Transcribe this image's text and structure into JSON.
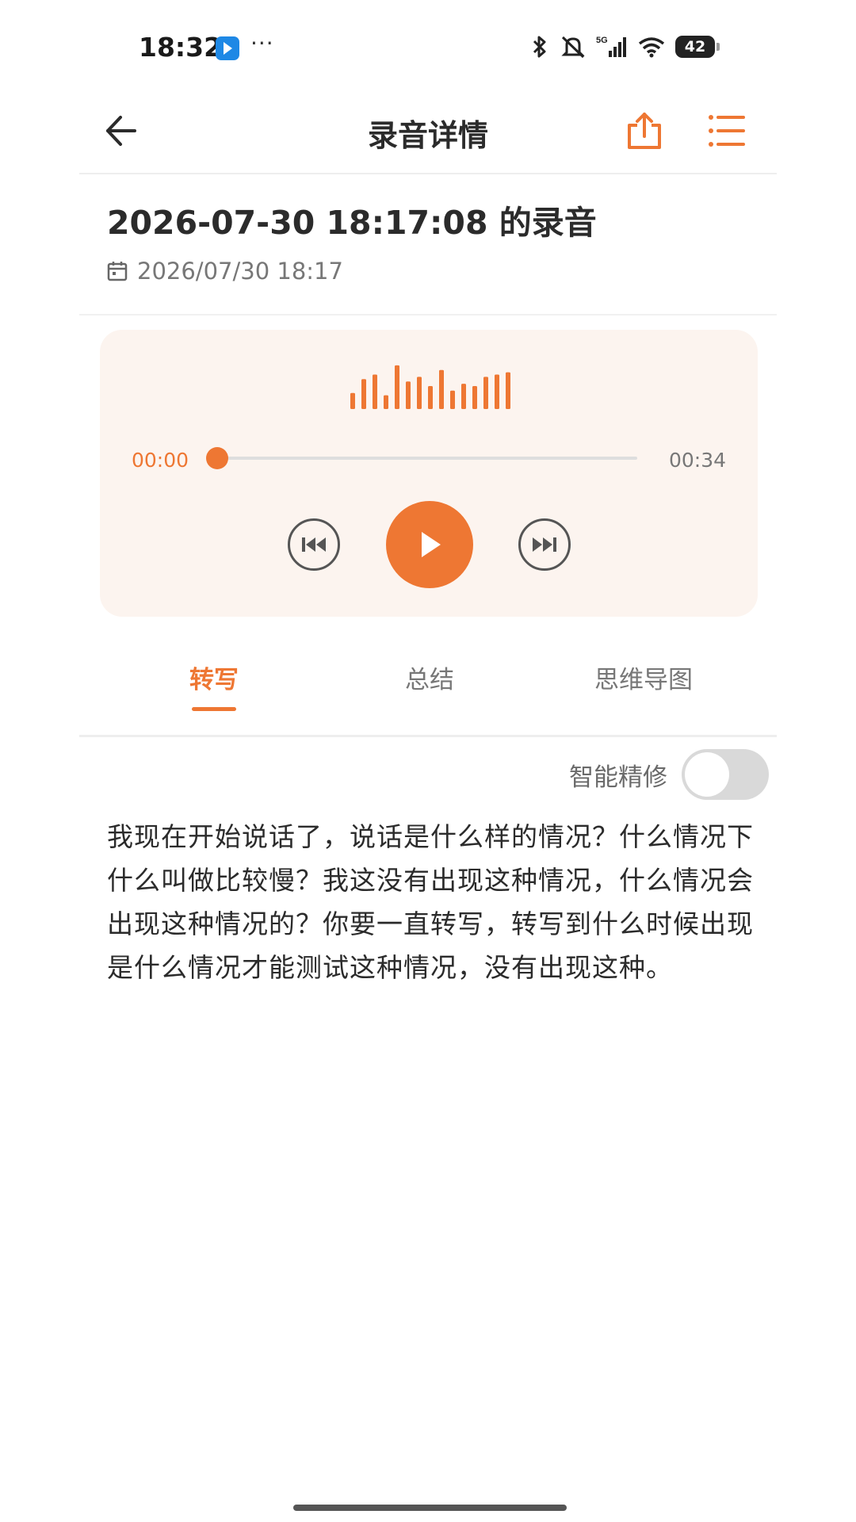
{
  "status_bar": {
    "time": "18:32",
    "overflow": "···",
    "network": "5G",
    "battery": "42",
    "icons": [
      "app-notification-icon",
      "bluetooth-icon",
      "mute-icon",
      "signal-icon",
      "wifi-icon",
      "battery-icon"
    ]
  },
  "nav": {
    "title": "录音详情",
    "back_icon": "arrow-left-icon",
    "share_icon": "share-icon",
    "menu_icon": "list-menu-icon"
  },
  "recording": {
    "title": "2026-07-30 18:17:08 的录音",
    "date": "2026/07/30 18:17",
    "date_icon": "calendar-icon"
  },
  "player": {
    "current_time": "00:00",
    "total_time": "00:34",
    "progress": 0,
    "waveform_levels": [
      0.35,
      0.65,
      0.75,
      0.3,
      0.95,
      0.6,
      0.7,
      0.5,
      0.85,
      0.4,
      0.55,
      0.5,
      0.7,
      0.75,
      0.8
    ],
    "prev_icon": "skip-back-icon",
    "play_icon": "play-icon",
    "next_icon": "skip-forward-icon"
  },
  "tabs": [
    {
      "label": "转写",
      "active": true
    },
    {
      "label": "总结",
      "active": false
    },
    {
      "label": "思维导图",
      "active": false
    }
  ],
  "smart_refine": {
    "label": "智能精修",
    "enabled": false
  },
  "transcript": {
    "text": "我现在开始说话了，说话是什么样的情况？什么情况下什么叫做比较慢？我这没有出现这种情况，什么情况会出现这种情况的？你要一直转写，转写到什么时候出现是什么情况才能测试这种情况，没有出现这种。"
  },
  "colors": {
    "accent": "#ee7733",
    "card_background": "#fcf4ef",
    "text_primary": "#2b2b2b",
    "text_secondary": "#777777"
  }
}
